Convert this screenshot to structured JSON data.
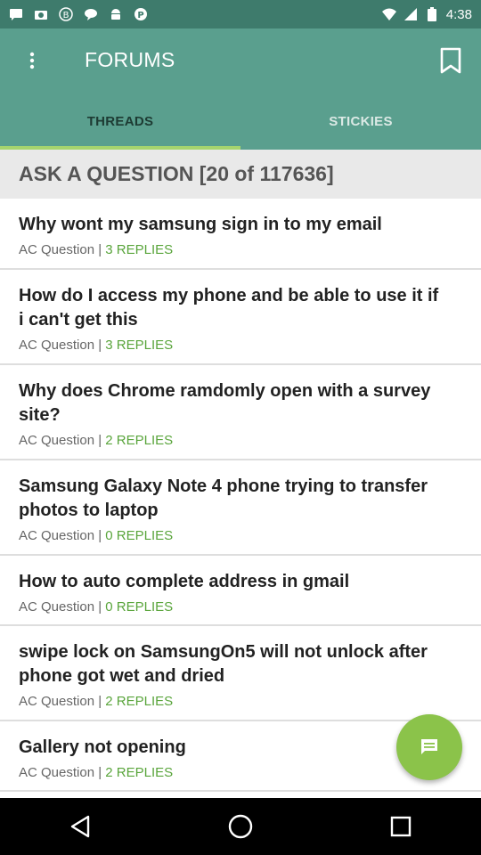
{
  "status_bar": {
    "time": "4:38",
    "left_icons": [
      "sms-icon",
      "camera-icon",
      "b-icon",
      "chat-bubble-icon",
      "android-icon",
      "pinterest-icon"
    ]
  },
  "app_bar": {
    "title": "FORUMS"
  },
  "tabs": [
    {
      "label": "THREADS",
      "active": true
    },
    {
      "label": "STICKIES",
      "active": false
    }
  ],
  "section": {
    "header": "ASK A QUESTION [20 of 117636]"
  },
  "threads": [
    {
      "title": "Why wont my samsung sign in to my email",
      "category": "AC Question |",
      "replies": "3 REPLIES"
    },
    {
      "title": "How do I access my phone and be able to use it if i can't get this",
      "category": "AC Question |",
      "replies": "3 REPLIES"
    },
    {
      "title": "Why does Chrome ramdomly open with a survey site?",
      "category": "AC Question |",
      "replies": "2 REPLIES"
    },
    {
      "title": "Samsung Galaxy Note 4 phone trying to transfer photos to laptop",
      "category": "AC Question |",
      "replies": "0 REPLIES"
    },
    {
      "title": "How to auto complete address in gmail",
      "category": "AC Question |",
      "replies": "0 REPLIES"
    },
    {
      "title": "swipe lock on SamsungOn5 will not unlock after phone got wet and dried",
      "category": "AC Question |",
      "replies": "2 REPLIES"
    },
    {
      "title": "Gallery  not opening",
      "category": "AC Question |",
      "replies": "2 REPLIES"
    }
  ],
  "colors": {
    "app_bar": "#5a9f8e",
    "status_bar": "#3e7b6c",
    "accent": "#8bc34a",
    "replies": "#5aa53c"
  }
}
